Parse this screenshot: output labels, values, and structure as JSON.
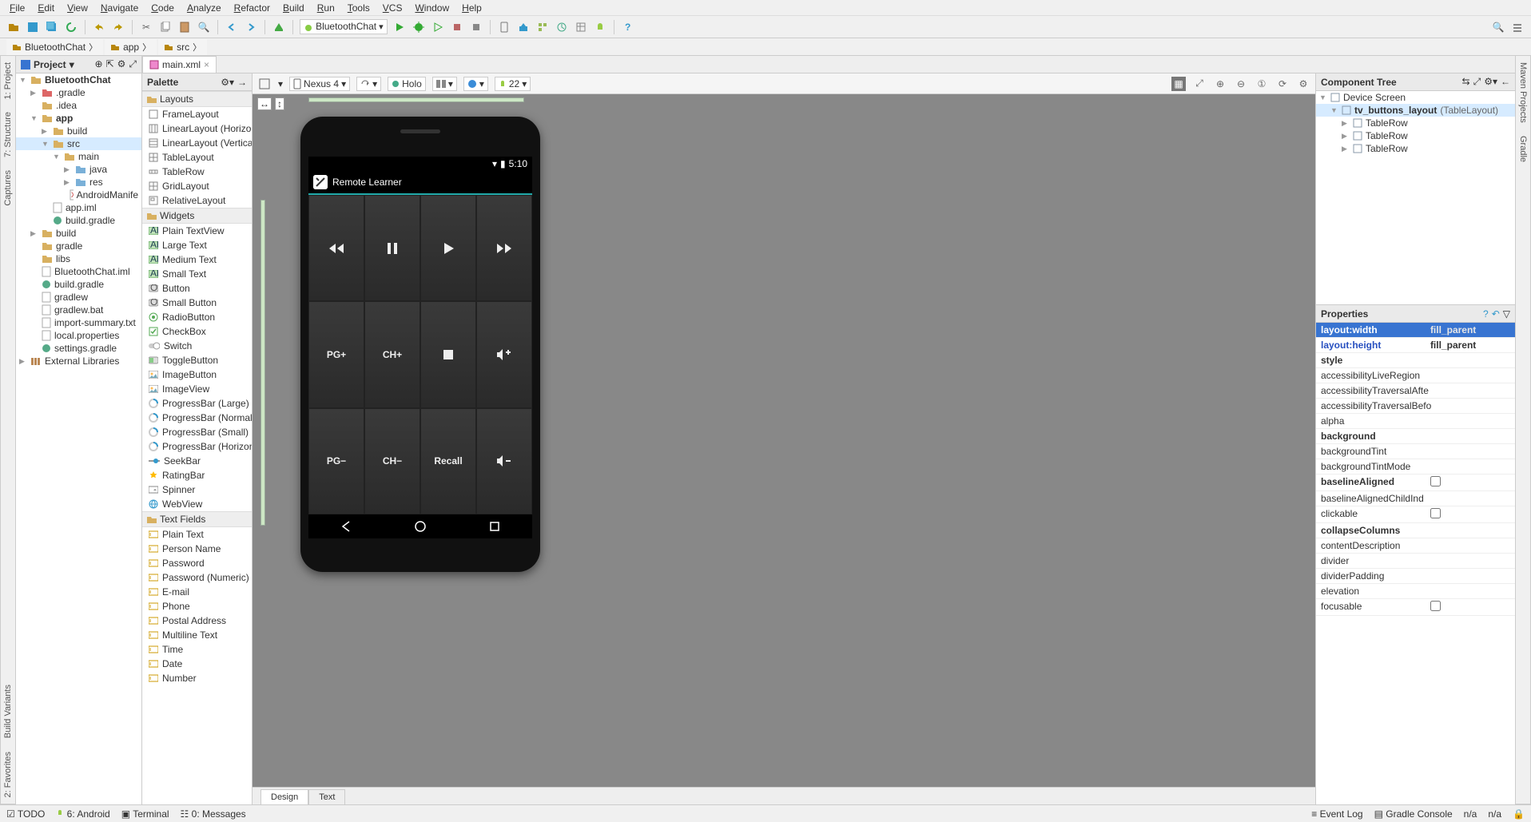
{
  "menu": [
    "File",
    "Edit",
    "View",
    "Navigate",
    "Code",
    "Analyze",
    "Refactor",
    "Build",
    "Run",
    "Tools",
    "VCS",
    "Window",
    "Help"
  ],
  "run_config": "BluetoothChat",
  "breadcrumb": [
    "BluetoothChat",
    "app",
    "src"
  ],
  "project_panel": {
    "title": "Project"
  },
  "project_tree": [
    {
      "lv": 0,
      "arrow": "▼",
      "ico": "mod",
      "label": "BluetoothChat",
      "bold": true
    },
    {
      "lv": 1,
      "arrow": "▶",
      "ico": "dirred",
      "label": ".gradle"
    },
    {
      "lv": 1,
      "arrow": "",
      "ico": "dir",
      "label": ".idea"
    },
    {
      "lv": 1,
      "arrow": "▼",
      "ico": "mod",
      "label": "app",
      "bold": true
    },
    {
      "lv": 2,
      "arrow": "▶",
      "ico": "dir",
      "label": "build"
    },
    {
      "lv": 2,
      "arrow": "▼",
      "ico": "dir",
      "label": "src",
      "sel": true
    },
    {
      "lv": 3,
      "arrow": "▼",
      "ico": "dir",
      "label": "main"
    },
    {
      "lv": 4,
      "arrow": "▶",
      "ico": "pkg",
      "label": "java"
    },
    {
      "lv": 4,
      "arrow": "▶",
      "ico": "pkg",
      "label": "res"
    },
    {
      "lv": 4,
      "arrow": "",
      "ico": "xml",
      "label": "AndroidManife"
    },
    {
      "lv": 2,
      "arrow": "",
      "ico": "file",
      "label": "app.iml"
    },
    {
      "lv": 2,
      "arrow": "",
      "ico": "grad",
      "label": "build.gradle"
    },
    {
      "lv": 1,
      "arrow": "▶",
      "ico": "dir",
      "label": "build"
    },
    {
      "lv": 1,
      "arrow": "",
      "ico": "dir",
      "label": "gradle"
    },
    {
      "lv": 1,
      "arrow": "",
      "ico": "dir",
      "label": "libs"
    },
    {
      "lv": 1,
      "arrow": "",
      "ico": "file",
      "label": "BluetoothChat.iml"
    },
    {
      "lv": 1,
      "arrow": "",
      "ico": "grad",
      "label": "build.gradle"
    },
    {
      "lv": 1,
      "arrow": "",
      "ico": "file",
      "label": "gradlew"
    },
    {
      "lv": 1,
      "arrow": "",
      "ico": "file",
      "label": "gradlew.bat"
    },
    {
      "lv": 1,
      "arrow": "",
      "ico": "txt",
      "label": "import-summary.txt"
    },
    {
      "lv": 1,
      "arrow": "",
      "ico": "file",
      "label": "local.properties"
    },
    {
      "lv": 1,
      "arrow": "",
      "ico": "grad",
      "label": "settings.gradle"
    },
    {
      "lv": 0,
      "arrow": "▶",
      "ico": "lib",
      "label": "External Libraries"
    }
  ],
  "palette": {
    "title": "Palette",
    "sections": [
      {
        "name": "Layouts",
        "items": [
          "FrameLayout",
          "LinearLayout (Horizontal)",
          "LinearLayout (Vertical)",
          "TableLayout",
          "TableRow",
          "GridLayout",
          "RelativeLayout"
        ]
      },
      {
        "name": "Widgets",
        "items": [
          "Plain TextView",
          "Large Text",
          "Medium Text",
          "Small Text",
          "Button",
          "Small Button",
          "RadioButton",
          "CheckBox",
          "Switch",
          "ToggleButton",
          "ImageButton",
          "ImageView",
          "ProgressBar (Large)",
          "ProgressBar (Normal)",
          "ProgressBar (Small)",
          "ProgressBar (Horizontal)",
          "SeekBar",
          "RatingBar",
          "Spinner",
          "WebView"
        ]
      },
      {
        "name": "Text Fields",
        "items": [
          "Plain Text",
          "Person Name",
          "Password",
          "Password (Numeric)",
          "E-mail",
          "Phone",
          "Postal Address",
          "Multiline Text",
          "Time",
          "Date",
          "Number"
        ]
      }
    ]
  },
  "editor_tab": "main.xml",
  "design_bar": {
    "device": "Nexus 4",
    "theme": "Holo",
    "api": "22"
  },
  "phone": {
    "status_time": "5:10",
    "app_title": "Remote Learner",
    "buttons": [
      [
        "⏪",
        "❚❚",
        "▶",
        "⏩"
      ],
      [
        "PG+",
        "CH+",
        "■",
        "🔊+"
      ],
      [
        "PG−",
        "CH−",
        "Recall",
        "🔊−"
      ]
    ]
  },
  "bottom_tabs": [
    "Design",
    "Text"
  ],
  "component_tree": {
    "title": "Component Tree",
    "items": [
      {
        "lv": 0,
        "arrow": "▼",
        "label": "Device Screen"
      },
      {
        "lv": 1,
        "arrow": "▼",
        "label": "tv_buttons_layout",
        "type": "(TableLayout)",
        "sel": true,
        "bold": true
      },
      {
        "lv": 2,
        "arrow": "▶",
        "label": "TableRow"
      },
      {
        "lv": 2,
        "arrow": "▶",
        "label": "TableRow"
      },
      {
        "lv": 2,
        "arrow": "▶",
        "label": "TableRow"
      }
    ]
  },
  "properties": {
    "title": "Properties",
    "rows": [
      {
        "name": "layout:width",
        "val": "fill_parent",
        "sel": true,
        "bold": true
      },
      {
        "name": "layout:height",
        "val": "fill_parent",
        "bold": true,
        "blue": true
      },
      {
        "name": "style",
        "val": "",
        "bold": true
      },
      {
        "name": "accessibilityLiveRegion",
        "val": ""
      },
      {
        "name": "accessibilityTraversalAfte",
        "val": ""
      },
      {
        "name": "accessibilityTraversalBefo",
        "val": ""
      },
      {
        "name": "alpha",
        "val": ""
      },
      {
        "name": "background",
        "val": "",
        "bold": true
      },
      {
        "name": "backgroundTint",
        "val": ""
      },
      {
        "name": "backgroundTintMode",
        "val": ""
      },
      {
        "name": "baselineAligned",
        "val": "☐",
        "bold": true
      },
      {
        "name": "baselineAlignedChildInd",
        "val": ""
      },
      {
        "name": "clickable",
        "val": "☐"
      },
      {
        "name": "collapseColumns",
        "val": "",
        "bold": true
      },
      {
        "name": "contentDescription",
        "val": ""
      },
      {
        "name": "divider",
        "val": ""
      },
      {
        "name": "dividerPadding",
        "val": ""
      },
      {
        "name": "elevation",
        "val": ""
      },
      {
        "name": "focusable",
        "val": "☐"
      }
    ]
  },
  "bottom_status": {
    "items": [
      "TODO",
      "6: Android",
      "Terminal",
      "0: Messages"
    ],
    "right": [
      "Event Log",
      "Gradle Console",
      "n/a",
      "n/a"
    ]
  },
  "sidebars": {
    "left": [
      "1: Project",
      "7: Structure",
      "Captures"
    ],
    "left_bottom": [
      "Build Variants",
      "2: Favorites"
    ],
    "right": [
      "Maven Projects",
      "Gradle"
    ]
  }
}
